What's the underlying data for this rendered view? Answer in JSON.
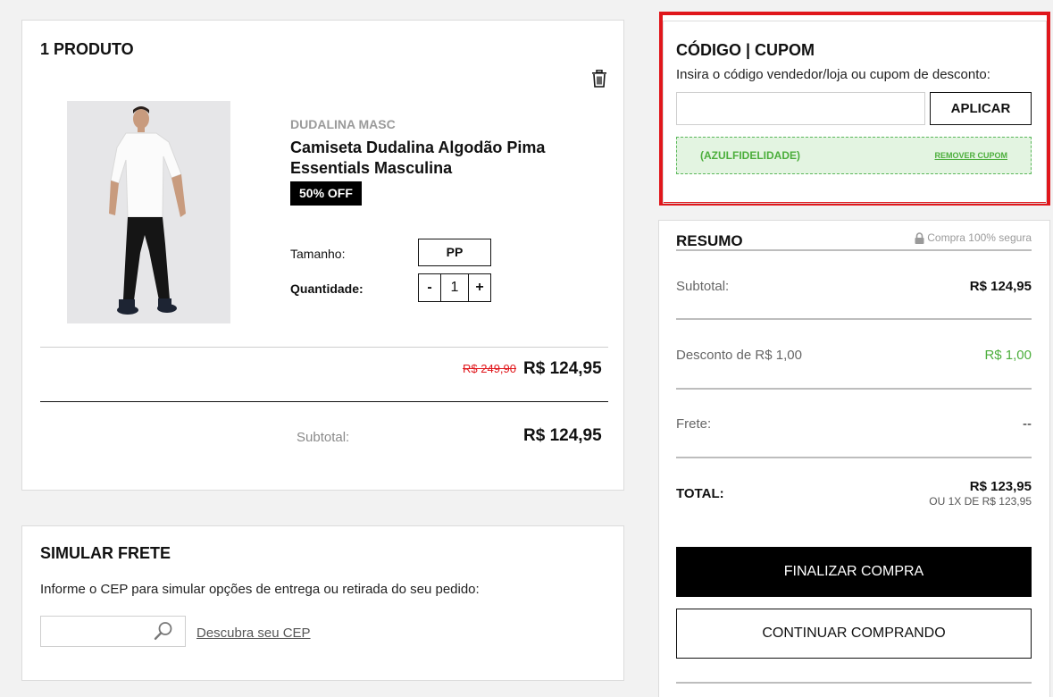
{
  "product_card": {
    "title": "1 PRODUTO",
    "item": {
      "brand": "DUDALINA MASC",
      "name": "Camiseta Dudalina Algodão Pima Essentials Masculina",
      "badge": "50% OFF",
      "size_label": "Tamanho:",
      "size_value": "PP",
      "qty_label": "Quantidade:",
      "qty_minus": "-",
      "qty_value": "1",
      "qty_plus": "+",
      "old_price": "R$ 249,90",
      "price": "R$ 124,95"
    },
    "subtotal_label": "Subtotal:",
    "subtotal_value": "R$ 124,95"
  },
  "frete_card": {
    "title": "SIMULAR FRETE",
    "description": "Informe o CEP para simular opções de entrega ou retirada do seu pedido:",
    "cep_placeholder": "",
    "cep_link": "Descubra seu CEP"
  },
  "coupon_card": {
    "title": "CÓDIGO | CUPOM",
    "description": "Insira o código vendedor/loja ou cupom de desconto:",
    "input_value": "",
    "apply_button": "APLICAR",
    "applied_code": "(AZULFIDELIDADE)",
    "remove_link": "REMOVER CUPOM",
    "highlight_color": "#e0161b"
  },
  "summary_card": {
    "title": "RESUMO",
    "secure_text": "Compra 100% segura",
    "subtotal_label": "Subtotal:",
    "subtotal_value": "R$ 124,95",
    "discount_label": "Desconto de R$ 1,00",
    "discount_value": "R$ 1,00",
    "frete_label": "Frete:",
    "frete_value": "--",
    "total_label": "TOTAL:",
    "total_value": "R$ 123,95",
    "installment": "OU 1X DE R$ 123,95",
    "finish_button": "FINALIZAR COMPRA",
    "continue_button": "CONTINUAR COMPRANDO",
    "discount_color": "#4cae3c"
  }
}
